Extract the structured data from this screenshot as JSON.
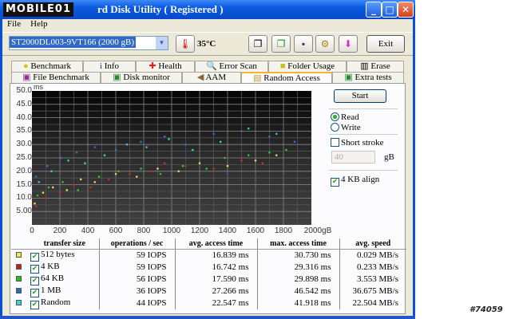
{
  "window": {
    "logo_text": "MOBILE01",
    "title": "rd Disk Utility ( Registered )",
    "min": "_",
    "max": "□",
    "close": "✕"
  },
  "menu": [
    "File",
    "Help"
  ],
  "toolbar": {
    "drive": "ST2000DL003-9VT166 (2000 gB)",
    "temperature": "35°C",
    "exit_label": "Exit",
    "icons": [
      "copy-text-icon",
      "copy-screenshot-icon",
      "save-icon",
      "options-icon",
      "download-icon"
    ]
  },
  "tabs": {
    "row1": [
      "Benchmark",
      "Info",
      "Health",
      "Error Scan",
      "Folder Usage",
      "Erase"
    ],
    "row2": [
      "File Benchmark",
      "Disk monitor",
      "AAM",
      "Random Access",
      "Extra tests"
    ],
    "active": "Random Access"
  },
  "side": {
    "start": "Start",
    "read": "Read",
    "write": "Write",
    "mode": "Read",
    "short_stroke": "Short stroke",
    "short_stroke_checked": false,
    "stroke_value": "40",
    "stroke_unit": "gB",
    "align": "4 KB align",
    "align_checked": true
  },
  "chart_data": {
    "type": "scatter",
    "ylabel": "ms",
    "xlabel": "gB",
    "xlim": [
      0,
      2000
    ],
    "ylim": [
      0,
      50
    ],
    "yticks": [
      "50.0",
      "45.0",
      "40.0",
      "35.0",
      "30.0",
      "25.0",
      "20.0",
      "15.0",
      "10.0",
      "5.00"
    ],
    "xticks": [
      "0",
      "200",
      "400",
      "600",
      "800",
      "1000",
      "1200",
      "1400",
      "1600",
      "1800",
      "2000gB"
    ],
    "grid": true,
    "series": [
      {
        "name": "512 bytes",
        "color": "#e8d84a",
        "points": [
          [
            20,
            8
          ],
          [
            80,
            12
          ],
          [
            150,
            14
          ],
          [
            250,
            13
          ],
          [
            350,
            17
          ],
          [
            450,
            16
          ],
          [
            600,
            19
          ],
          [
            750,
            18
          ],
          [
            900,
            21
          ],
          [
            1050,
            20
          ],
          [
            1200,
            23
          ],
          [
            1400,
            22
          ],
          [
            1600,
            24
          ],
          [
            1750,
            26
          ]
        ]
      },
      {
        "name": "4 KB",
        "color": "#c83020",
        "points": [
          [
            30,
            7
          ],
          [
            100,
            10
          ],
          [
            200,
            12
          ],
          [
            300,
            15
          ],
          [
            420,
            14
          ],
          [
            550,
            17
          ],
          [
            700,
            19
          ],
          [
            850,
            20
          ],
          [
            950,
            23
          ],
          [
            1100,
            22
          ],
          [
            1300,
            21
          ],
          [
            1500,
            24
          ],
          [
            1650,
            23
          ]
        ]
      },
      {
        "name": "64 KB",
        "color": "#30c830",
        "points": [
          [
            40,
            11
          ],
          [
            120,
            14
          ],
          [
            220,
            16
          ],
          [
            330,
            13
          ],
          [
            480,
            18
          ],
          [
            620,
            20
          ],
          [
            780,
            21
          ],
          [
            920,
            19
          ],
          [
            1080,
            22
          ],
          [
            1250,
            21
          ],
          [
            1380,
            25
          ],
          [
            1550,
            26
          ],
          [
            1700,
            27
          ],
          [
            1820,
            28
          ]
        ]
      },
      {
        "name": "1 MB",
        "color": "#2878c8",
        "points": [
          [
            30,
            18
          ],
          [
            110,
            22
          ],
          [
            210,
            25
          ],
          [
            320,
            27
          ],
          [
            450,
            29
          ],
          [
            600,
            28
          ],
          [
            780,
            31
          ],
          [
            950,
            33
          ],
          [
            1100,
            30
          ],
          [
            1300,
            34
          ],
          [
            1500,
            35
          ],
          [
            1700,
            33
          ],
          [
            1880,
            31
          ]
        ]
      },
      {
        "name": "Random",
        "color": "#40c8d0",
        "points": [
          [
            50,
            16
          ],
          [
            140,
            20
          ],
          [
            260,
            24
          ],
          [
            380,
            23
          ],
          [
            520,
            26
          ],
          [
            680,
            30
          ],
          [
            820,
            29
          ],
          [
            980,
            32
          ],
          [
            1150,
            28
          ],
          [
            1350,
            31
          ],
          [
            1550,
            36
          ],
          [
            1750,
            34
          ]
        ]
      }
    ]
  },
  "table": {
    "headers": [
      "transfer size",
      "operations / sec",
      "avg. access time",
      "max. access time",
      "avg. speed"
    ],
    "rows": [
      {
        "color": "#e8e84a",
        "checked": true,
        "size": "512 bytes",
        "ops": "59 IOPS",
        "avg": "16.839 ms",
        "max": "30.730 ms",
        "speed": "0.029 MB/s"
      },
      {
        "color": "#c02020",
        "checked": true,
        "size": "4 KB",
        "ops": "59 IOPS",
        "avg": "16.742 ms",
        "max": "29.316 ms",
        "speed": "0.233 MB/s"
      },
      {
        "color": "#20c020",
        "checked": true,
        "size": "64 KB",
        "ops": "56 IOPS",
        "avg": "17.590 ms",
        "max": "29.898 ms",
        "speed": "3.553 MB/s"
      },
      {
        "color": "#2070c0",
        "checked": true,
        "size": "1 MB",
        "ops": "36 IOPS",
        "avg": "27.266 ms",
        "max": "46.542 ms",
        "speed": "36.675 MB/s"
      },
      {
        "color": "#40d0d0",
        "checked": true,
        "size": "Random",
        "ops": "44 IOPS",
        "avg": "22.547 ms",
        "max": "41.918 ms",
        "speed": "22.504 MB/s"
      }
    ]
  },
  "footer": "#74059"
}
